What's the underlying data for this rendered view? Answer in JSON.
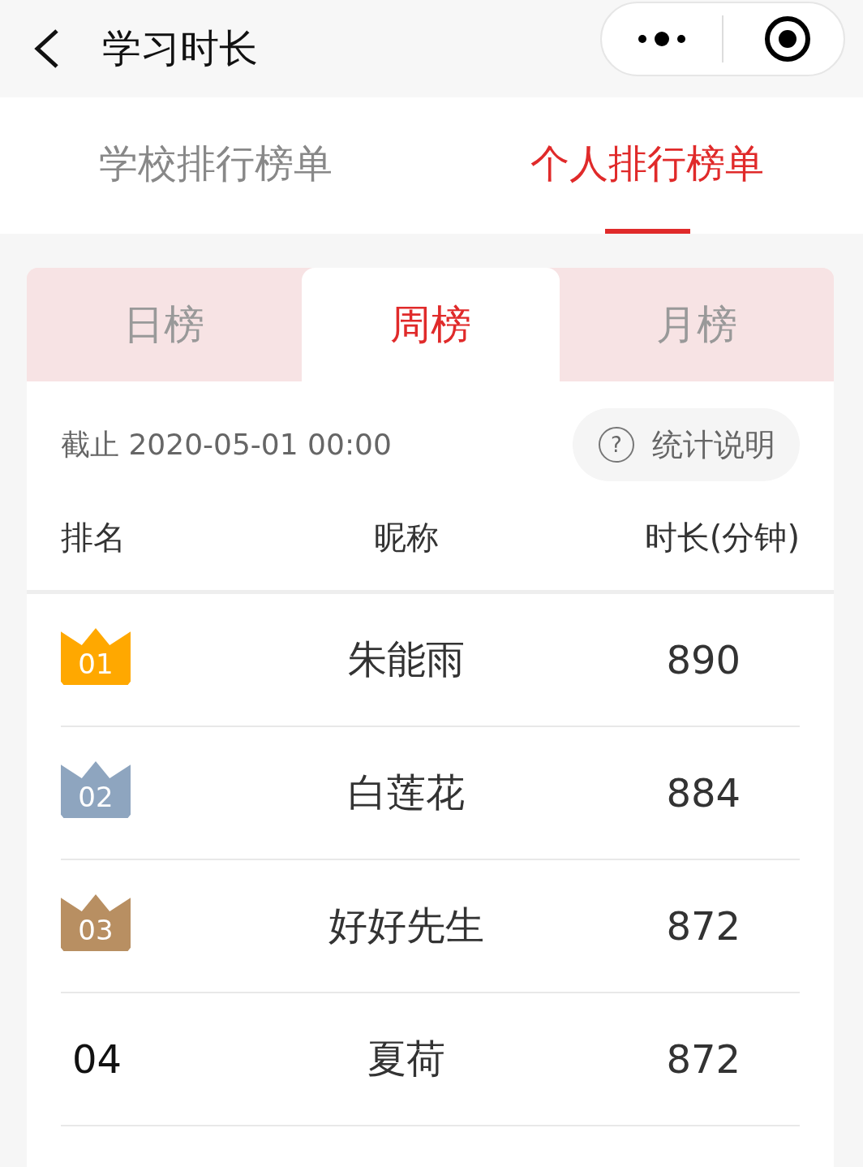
{
  "nav": {
    "title": "学习时长"
  },
  "tabs": [
    {
      "label": "学校排行榜单",
      "selected": false
    },
    {
      "label": "个人排行榜单",
      "selected": true
    }
  ],
  "periods": [
    {
      "label": "日榜",
      "selected": false
    },
    {
      "label": "周榜",
      "selected": true
    },
    {
      "label": "月榜",
      "selected": false
    }
  ],
  "cutoff": "截止 2020-05-01 00:00",
  "help_button": {
    "icon": "?",
    "label": "统计说明"
  },
  "columns": [
    "排名",
    "昵称",
    "时长(分钟)"
  ],
  "rows": [
    {
      "kind": "crown",
      "rank": "01",
      "color": "#ffa800",
      "name": "朱能雨",
      "minutes": "890"
    },
    {
      "kind": "crown",
      "rank": "02",
      "color": "#8ea5bf",
      "name": "白莲花",
      "minutes": "884"
    },
    {
      "kind": "crown",
      "rank": "03",
      "color": "#b88f62",
      "name": "好好先生",
      "minutes": "872"
    },
    {
      "kind": "plain",
      "rank": "04",
      "name": "夏荷",
      "minutes": "872"
    }
  ]
}
